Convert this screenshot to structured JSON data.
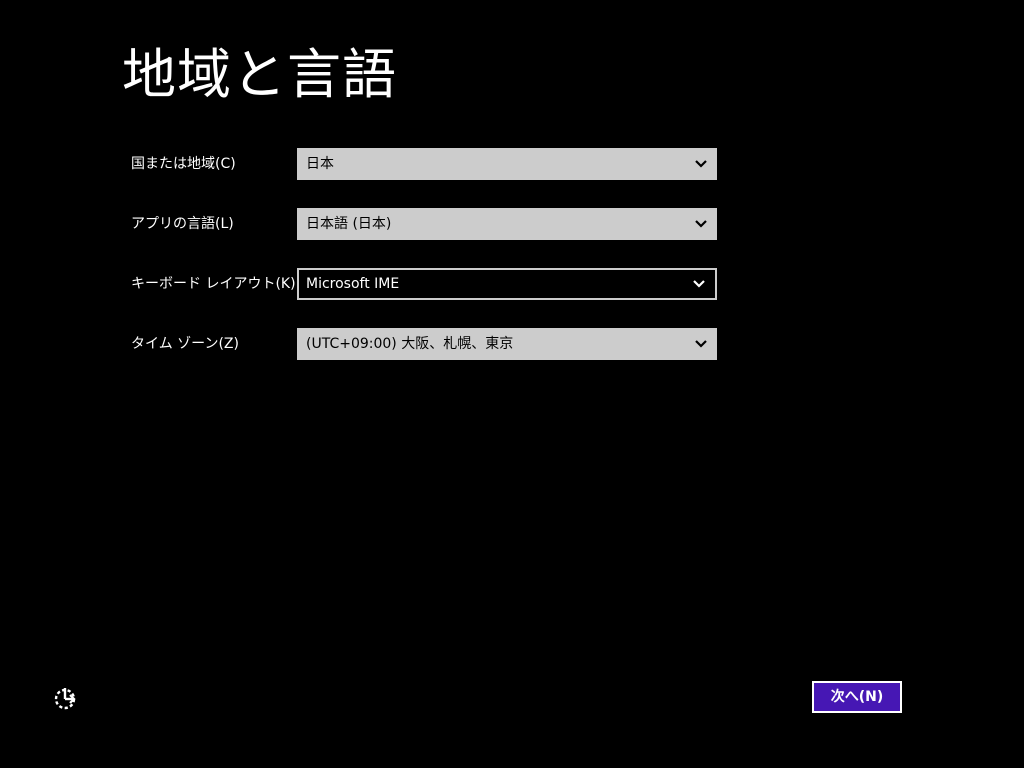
{
  "title": "地域と言語",
  "fields": [
    {
      "label": "国または地域(C)",
      "value": "日本"
    },
    {
      "label": "アプリの言語(L)",
      "value": "日本語 (日本)"
    },
    {
      "label": "キーボード レイアウト(K)",
      "value": "Microsoft IME"
    },
    {
      "label": "タイム ゾーン(Z)",
      "value": "(UTC+09:00) 大阪、札幌、東京"
    }
  ],
  "footer": {
    "ease_of_access_icon": "ease-of-access-icon",
    "next_label": "次へ(N)"
  },
  "colors": {
    "background": "#000000",
    "accent": "#4617b4",
    "select_background": "#cccccc"
  }
}
